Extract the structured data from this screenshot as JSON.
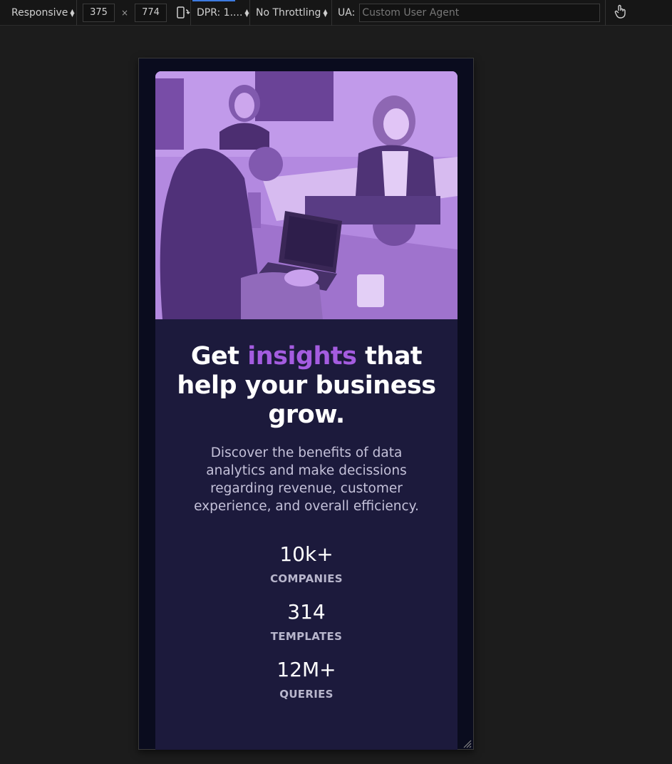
{
  "toolbar": {
    "responsive_label": "Responsive",
    "width": "375",
    "times": "×",
    "height": "774",
    "dpr_label": "DPR: 1....",
    "throttling_label": "No Throttling",
    "ua_label": "UA:",
    "ua_placeholder": "Custom User Agent"
  },
  "card": {
    "headline_before": "Get ",
    "headline_accent": "insights",
    "headline_after": " that help your business grow.",
    "description": "Discover the benefits of data analytics and make decissions regarding revenue, customer experience, and overall efficiency.",
    "stats": [
      {
        "value": "10k+",
        "label": "COMPANIES"
      },
      {
        "value": "314",
        "label": "TEMPLATES"
      },
      {
        "value": "12M+",
        "label": "QUERIES"
      }
    ]
  },
  "colors": {
    "page_bg": "#0a0c1e",
    "card_bg": "#1c1a3c",
    "accent": "#a45ce0",
    "hero_tint": "#a27fd0"
  }
}
